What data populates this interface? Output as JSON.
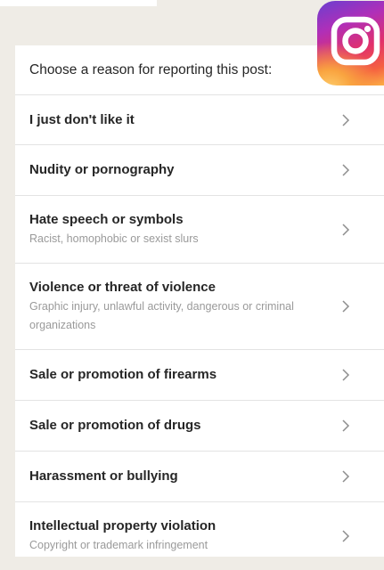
{
  "header": {
    "text": "Choose a reason for reporting this post:"
  },
  "reasons": [
    {
      "title": "I just don't like it"
    },
    {
      "title": "Nudity or pornography"
    },
    {
      "title": "Hate speech or symbols",
      "subtitle": "Racist, homophobic or sexist slurs"
    },
    {
      "title": "Violence or threat of violence",
      "subtitle": "Graphic injury, unlawful activity, dangerous or criminal organizations"
    },
    {
      "title": "Sale or promotion of firearms"
    },
    {
      "title": "Sale or promotion of drugs"
    },
    {
      "title": "Harassment or bullying"
    },
    {
      "title": "Intellectual property violation",
      "subtitle": "Copyright or trademark infringement"
    }
  ],
  "icons": {
    "logo": "instagram-logo-icon",
    "chevron": "chevron-right-icon"
  },
  "colors": {
    "background": "#efece6",
    "panel": "#ffffff",
    "title_text": "#262626",
    "subtitle_text": "#9a9a9a",
    "divider": "#e3e3e3"
  }
}
